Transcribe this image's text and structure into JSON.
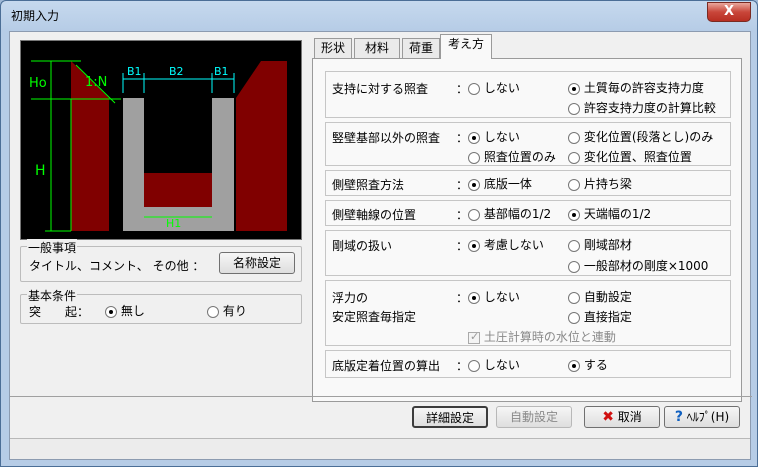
{
  "window": {
    "title": "初期入力",
    "close_glyph": "X"
  },
  "diagram": {
    "labels": {
      "ho": "Ho",
      "slope": "1:N",
      "b1_left": "B1",
      "b2": "B2",
      "b1_right": "B1",
      "h": "H",
      "h1": "H1"
    },
    "colors": {
      "fill": "#800000",
      "wall": "#a0a0a0",
      "dim": "#00ff00",
      "dim_top": "#00ffff"
    }
  },
  "general": {
    "legend": "一般事項",
    "text": "タイトル、コメント、 その他 ：",
    "button": "名称設定"
  },
  "basic": {
    "legend": "基本条件",
    "label": "突　　起：",
    "options": [
      "無し",
      "有り"
    ],
    "selected": 0
  },
  "tabs": [
    "形状",
    "材料",
    "荷重",
    "考え方"
  ],
  "active_tab": 3,
  "settings": [
    {
      "label": "支持に対する照査",
      "colon": "：",
      "options": [
        "しない",
        "土質毎の許容支持力度",
        "許容支持力度の計算比較"
      ],
      "selected": 1
    },
    {
      "label": "竪壁基部以外の照査",
      "colon": "：",
      "options": [
        "しない",
        "変化位置(段落とし)のみ",
        "照査位置のみ",
        "変化位置、照査位置"
      ],
      "selected": 0
    },
    {
      "label": "側壁照査方法",
      "colon": "：",
      "options": [
        "底版一体",
        "片持ち梁"
      ],
      "selected": 0
    },
    {
      "label": "側壁軸線の位置",
      "colon": "：",
      "options": [
        "基部幅の1/2",
        "天端幅の1/2"
      ],
      "selected": 1
    },
    {
      "label": "剛域の扱い",
      "colon": "：",
      "options": [
        "考慮しない",
        "剛域部材",
        "一般部材の剛度×1000"
      ],
      "selected": 0
    },
    {
      "label1": "浮力の",
      "label2": "安定照査毎指定",
      "colon": "：",
      "options": [
        "しない",
        "自動設定",
        "直接指定"
      ],
      "selected": 0,
      "checkbox": "土圧計算時の水位と連動"
    },
    {
      "label": "底版定着位置の算出",
      "colon": "：",
      "options": [
        "しない",
        "する"
      ],
      "selected": 1
    }
  ],
  "footer": {
    "detail": "詳細設定",
    "auto": "自動設定",
    "cancel": "取消",
    "help": "ﾍﾙﾌﾟ(H)"
  }
}
